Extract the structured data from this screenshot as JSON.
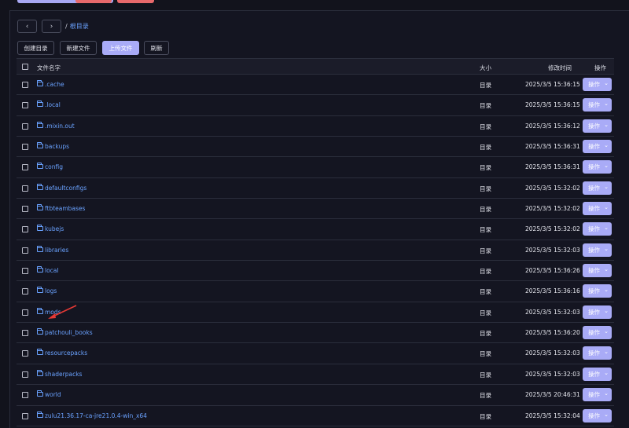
{
  "breadcrumb": {
    "separator": "/",
    "current": "根目录"
  },
  "actions": {
    "create_dir": "创建目录",
    "new_file": "新建文件",
    "upload": "上传文件",
    "refresh": "刷新"
  },
  "table": {
    "headers": {
      "name": "文件名字",
      "size": "大小",
      "modified": "修改时间",
      "ops": "操作"
    },
    "rows": [
      {
        "name": ".cache",
        "size": "目录",
        "modified": "2025/3/5 15:36:15",
        "op": "操作"
      },
      {
        "name": ".local",
        "size": "目录",
        "modified": "2025/3/5 15:36:15",
        "op": "操作"
      },
      {
        "name": ".mixin.out",
        "size": "目录",
        "modified": "2025/3/5 15:36:12",
        "op": "操作"
      },
      {
        "name": "backups",
        "size": "目录",
        "modified": "2025/3/5 15:36:31",
        "op": "操作"
      },
      {
        "name": "config",
        "size": "目录",
        "modified": "2025/3/5 15:36:31",
        "op": "操作"
      },
      {
        "name": "defaultconfigs",
        "size": "目录",
        "modified": "2025/3/5 15:32:02",
        "op": "操作"
      },
      {
        "name": "ftbteambases",
        "size": "目录",
        "modified": "2025/3/5 15:32:02",
        "op": "操作"
      },
      {
        "name": "kubejs",
        "size": "目录",
        "modified": "2025/3/5 15:32:02",
        "op": "操作"
      },
      {
        "name": "libraries",
        "size": "目录",
        "modified": "2025/3/5 15:32:03",
        "op": "操作"
      },
      {
        "name": "local",
        "size": "目录",
        "modified": "2025/3/5 15:36:26",
        "op": "操作"
      },
      {
        "name": "logs",
        "size": "目录",
        "modified": "2025/3/5 15:36:16",
        "op": "操作"
      },
      {
        "name": "mods",
        "size": "目录",
        "modified": "2025/3/5 15:32:03",
        "op": "操作"
      },
      {
        "name": "patchouli_books",
        "size": "目录",
        "modified": "2025/3/5 15:36:20",
        "op": "操作"
      },
      {
        "name": "resourcepacks",
        "size": "目录",
        "modified": "2025/3/5 15:32:03",
        "op": "操作"
      },
      {
        "name": "shaderpacks",
        "size": "目录",
        "modified": "2025/3/5 15:32:03",
        "op": "操作"
      },
      {
        "name": "world",
        "size": "目录",
        "modified": "2025/3/5 20:46:31",
        "op": "操作"
      },
      {
        "name": "zulu21.36.17-ca-jre21.0.4-win_x64",
        "size": "目录",
        "modified": "2025/3/5 15:32:04",
        "op": "操作"
      }
    ]
  },
  "icons": {
    "back": "chevron-left-icon",
    "forward": "chevron-right-icon",
    "folder": "folder-icon",
    "dropdown": "chevron-down-icon",
    "annotation": "red-arrow-annotation"
  },
  "colors": {
    "accent": "#a9abf7",
    "link": "#6aa2ff",
    "danger": "#e8696b",
    "annotation": "#e53935"
  }
}
